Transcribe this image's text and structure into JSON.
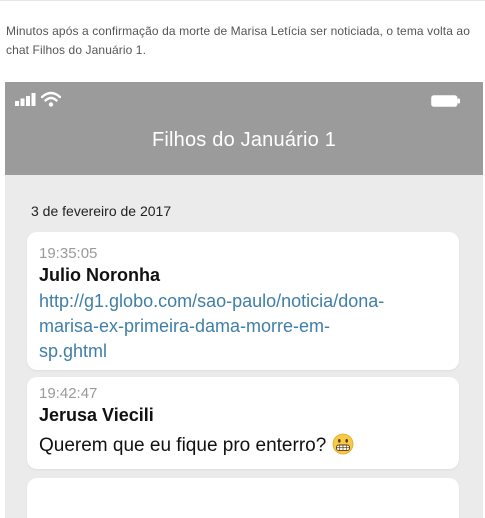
{
  "caption": "Minutos após a confirmação da morte de Marisa Letícia ser noticiada, o tema volta ao chat Filhos do Januário 1.",
  "status_bar": {
    "signal_icon": "signal-bars-icon",
    "wifi_icon": "wifi-icon",
    "battery_icon": "battery-icon"
  },
  "chat": {
    "title": "Filhos do Januário 1",
    "date": "3 de fevereiro de 2017",
    "messages": [
      {
        "time": "19:35:05",
        "sender": "Julio Noronha",
        "text": "http://g1.globo.com/sao-paulo/noticia/dona-marisa-ex-primeira-dama-morre-em-sp.ghtml"
      },
      {
        "time": "19:42:47",
        "sender": "Jerusa Viecili",
        "text": "Querem que eu fique pro enterro?",
        "emoji": "grimacing-face-icon"
      }
    ]
  },
  "colors": {
    "header_bg": "#9b9b9b",
    "chat_bg": "#ebebeb",
    "link": "#3f7fa6"
  }
}
